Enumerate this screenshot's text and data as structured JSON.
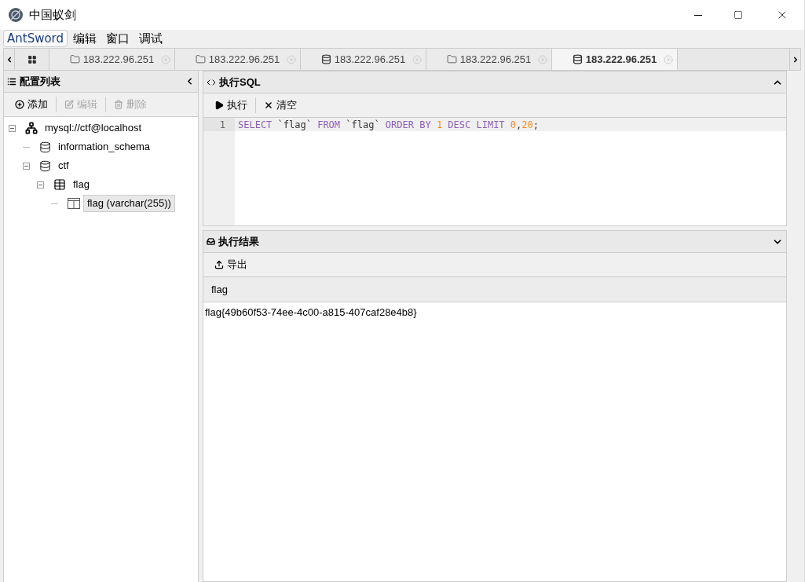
{
  "window": {
    "title": "中国蚁剑"
  },
  "menu": [
    {
      "label": "AntSword",
      "selected": true
    },
    {
      "label": "编辑",
      "selected": false
    },
    {
      "label": "窗口",
      "selected": false
    },
    {
      "label": "调试",
      "selected": false
    }
  ],
  "tabs": [
    {
      "label": "183.222.96.251",
      "kind": "folder",
      "selected": false
    },
    {
      "label": "183.222.96.251",
      "kind": "folder",
      "selected": false
    },
    {
      "label": "183.222.96.251",
      "kind": "database",
      "selected": false
    },
    {
      "label": "183.222.96.251",
      "kind": "folder",
      "selected": false
    },
    {
      "label": "183.222.96.251",
      "kind": "database",
      "selected": true
    }
  ],
  "sidebar": {
    "title": "配置列表",
    "toolbar": [
      {
        "label": "添加",
        "kind": "add",
        "disabled": false
      },
      {
        "label": "编辑",
        "kind": "edit",
        "disabled": true
      },
      {
        "label": "删除",
        "kind": "delete",
        "disabled": true
      }
    ],
    "tree": [
      {
        "label": "mysql://ctf@localhost",
        "kind": "connection",
        "expanded": true,
        "selected": false,
        "children": [
          {
            "label": "information_schema",
            "kind": "database",
            "selected": false
          },
          {
            "label": "ctf",
            "kind": "database",
            "expanded": true,
            "selected": false,
            "children": [
              {
                "label": "flag",
                "kind": "table",
                "expanded": true,
                "selected": false,
                "children": [
                  {
                    "label": "flag (varchar(255))",
                    "kind": "column",
                    "selected": true
                  }
                ]
              }
            ]
          }
        ]
      }
    ]
  },
  "sql_panel": {
    "title": "执行SQL",
    "toolbar": [
      {
        "label": "执行",
        "kind": "run"
      },
      {
        "label": "清空",
        "kind": "clear"
      }
    ],
    "lines": [
      {
        "number": "1",
        "tokens": [
          {
            "text": "SELECT",
            "kind": "keyword"
          },
          {
            "text": " `flag` ",
            "kind": "plain"
          },
          {
            "text": "FROM",
            "kind": "keyword"
          },
          {
            "text": " `flag` ",
            "kind": "plain"
          },
          {
            "text": "ORDER BY ",
            "kind": "keyword"
          },
          {
            "text": "1",
            "kind": "number"
          },
          {
            "text": " DESC LIMIT ",
            "kind": "keyword"
          },
          {
            "text": "0",
            "kind": "number"
          },
          {
            "text": ",",
            "kind": "plain"
          },
          {
            "text": "20",
            "kind": "number"
          },
          {
            "text": ";",
            "kind": "plain"
          }
        ]
      }
    ]
  },
  "result_panel": {
    "title": "执行结果",
    "toolbar": [
      {
        "label": "导出",
        "kind": "export"
      }
    ],
    "table": {
      "columns": [
        "flag"
      ],
      "rows": [
        [
          "flag{49b60f53-74ee-4c00-a815-407caf28e4b8}"
        ]
      ]
    }
  }
}
